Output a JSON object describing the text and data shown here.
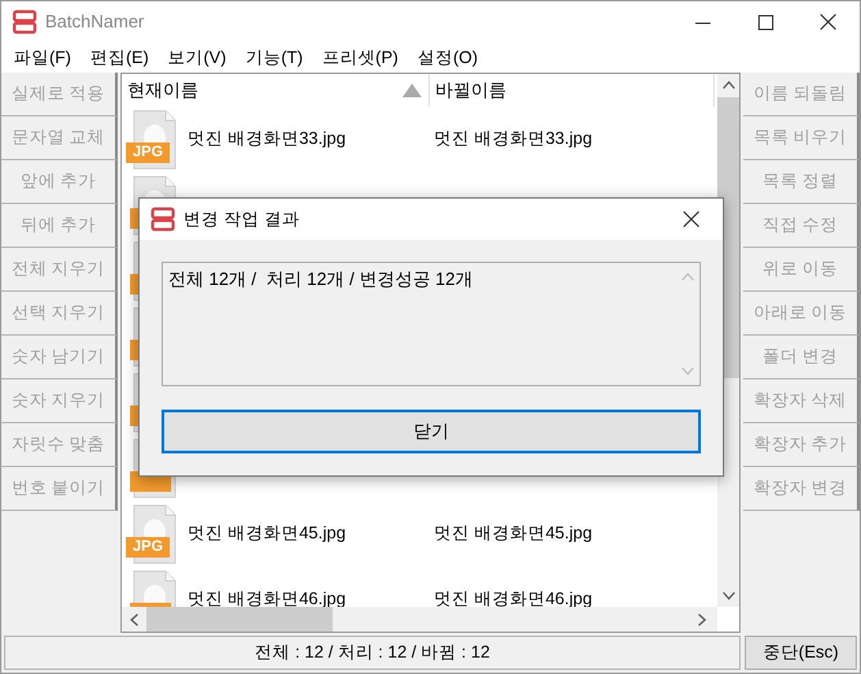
{
  "window": {
    "title": "BatchNamer"
  },
  "menu": [
    "파일(F)",
    "편집(E)",
    "보기(V)",
    "기능(T)",
    "프리셋(P)",
    "설정(O)"
  ],
  "left_buttons": [
    {
      "label": "실제로 적용",
      "disabled": true
    },
    {
      "label": "문자열 교체",
      "disabled": true
    },
    {
      "label": "앞에 추가",
      "disabled": true
    },
    {
      "label": "뒤에 추가",
      "disabled": true
    },
    {
      "label": "전체 지우기",
      "disabled": true
    },
    {
      "label": "선택 지우기",
      "disabled": true
    },
    {
      "label": "숫자 남기기",
      "disabled": true
    },
    {
      "label": "숫자 지우기",
      "disabled": true
    },
    {
      "label": "자릿수 맞춤",
      "disabled": true
    },
    {
      "label": "번호 붙이기",
      "disabled": true
    }
  ],
  "right_buttons": [
    {
      "label": "이름 되돌림",
      "disabled": true
    },
    {
      "label": "목록 비우기",
      "disabled": true
    },
    {
      "label": "목록 정렬",
      "disabled": true
    },
    {
      "label": "직접 수정",
      "disabled": true
    },
    {
      "label": "위로 이동",
      "disabled": true
    },
    {
      "label": "아래로 이동",
      "disabled": true
    },
    {
      "label": "폴더 변경",
      "disabled": true
    },
    {
      "label": "확장자 삭제",
      "disabled": true
    },
    {
      "label": "확장자 추가",
      "disabled": true
    },
    {
      "label": "확장자 변경",
      "disabled": true
    }
  ],
  "file_list": {
    "columns": [
      {
        "label": "현재이름",
        "sort_ascending": true
      },
      {
        "label": "바뀔이름"
      }
    ],
    "rows": [
      {
        "kind": "file",
        "badge": "JPG",
        "current_name": "멋진 배경화면33.jpg",
        "new_name": "멋진 배경화면33.jpg"
      },
      {
        "kind": "covered"
      },
      {
        "kind": "covered"
      },
      {
        "kind": "covered"
      },
      {
        "kind": "covered"
      },
      {
        "kind": "file"
      },
      {
        "kind": "file",
        "badge": "JPG",
        "current_name": "멋진 배경화면45.jpg",
        "new_name": "멋진 배경화면45.jpg"
      },
      {
        "kind": "file",
        "current_name": "멋진 배경화면46.jpg",
        "new_name": "멋진 배경화면46.jpg"
      }
    ]
  },
  "status_bar": {
    "summary": "전체 : 12 / 처리 : 12 / 바뀜 : 12",
    "stop_button": "중단(Esc)"
  },
  "dialog": {
    "title": "변경 작업 결과",
    "message": "전체 12개 /  처리 12개 / 변경성공 12개",
    "close_button": "닫기",
    "focused": true
  }
}
